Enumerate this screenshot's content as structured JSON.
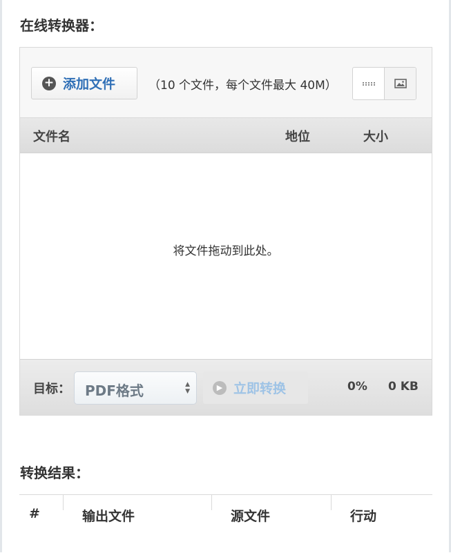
{
  "converter": {
    "title": "在线转换器：",
    "toolbar": {
      "add_files_label": "添加文件",
      "limit_hint": "（10 个文件，每个文件最大 40M）",
      "source_buttons": [
        "dots-source",
        "image-source"
      ]
    },
    "file_list": {
      "columns": [
        "文件名",
        "地位",
        "大小"
      ],
      "empty_text": "将文件拖动到此处。"
    },
    "footer": {
      "target_label": "目标：",
      "format_value": "PDF格式",
      "convert_label": "立即转换",
      "progress": "0%",
      "total_size": "0 KB"
    }
  },
  "results": {
    "title": "转换结果：",
    "columns": [
      "#",
      "输出文件",
      "源文件",
      "行动"
    ]
  },
  "colors": {
    "link_blue": "#2f6fb6",
    "disabled_blue": "#9ec3e6",
    "border": "#d9d9d9"
  }
}
